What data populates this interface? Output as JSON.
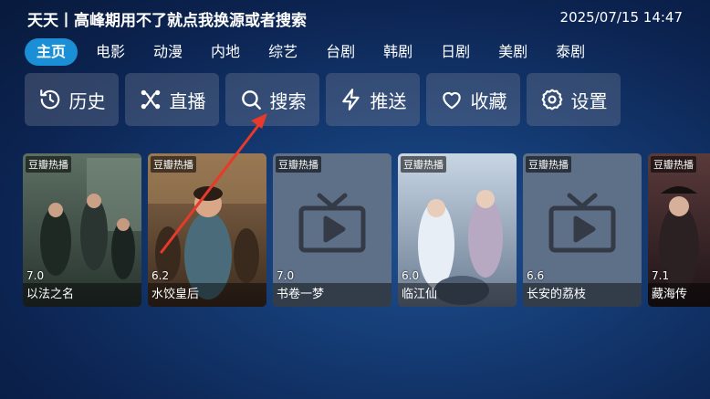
{
  "header": {
    "title": "天天丨高峰期用不了就点我换源或者搜索",
    "datetime": "2025/07/15 14:47"
  },
  "tabs": [
    {
      "label": "主页",
      "active": true
    },
    {
      "label": "电影"
    },
    {
      "label": "动漫"
    },
    {
      "label": "内地"
    },
    {
      "label": "综艺"
    },
    {
      "label": "台剧"
    },
    {
      "label": "韩剧"
    },
    {
      "label": "日剧"
    },
    {
      "label": "美剧"
    },
    {
      "label": "泰剧"
    }
  ],
  "actions": [
    {
      "label": "历史",
      "icon": "history-icon"
    },
    {
      "label": "直播",
      "icon": "live-icon"
    },
    {
      "label": "搜索",
      "icon": "search-icon"
    },
    {
      "label": "推送",
      "icon": "lightning-icon"
    },
    {
      "label": "收藏",
      "icon": "heart-icon"
    },
    {
      "label": "设置",
      "icon": "gear-icon"
    }
  ],
  "cards": [
    {
      "badge": "豆瓣热播",
      "rating": "7.0",
      "title": "以法之名",
      "poster": "photo"
    },
    {
      "badge": "豆瓣热播",
      "rating": "6.2",
      "title": "水饺皇后",
      "poster": "photo"
    },
    {
      "badge": "豆瓣热播",
      "rating": "7.0",
      "title": "书卷一梦",
      "poster": "placeholder"
    },
    {
      "badge": "豆瓣热播",
      "rating": "6.0",
      "title": "临江仙",
      "poster": "photo"
    },
    {
      "badge": "豆瓣热播",
      "rating": "6.6",
      "title": "长安的荔枝",
      "poster": "placeholder"
    },
    {
      "badge": "豆瓣热播",
      "rating": "7.1",
      "title": "藏海传",
      "poster": "photo"
    }
  ],
  "colors": {
    "accent": "#1a8fd6",
    "annotation_arrow": "#e8392a"
  }
}
